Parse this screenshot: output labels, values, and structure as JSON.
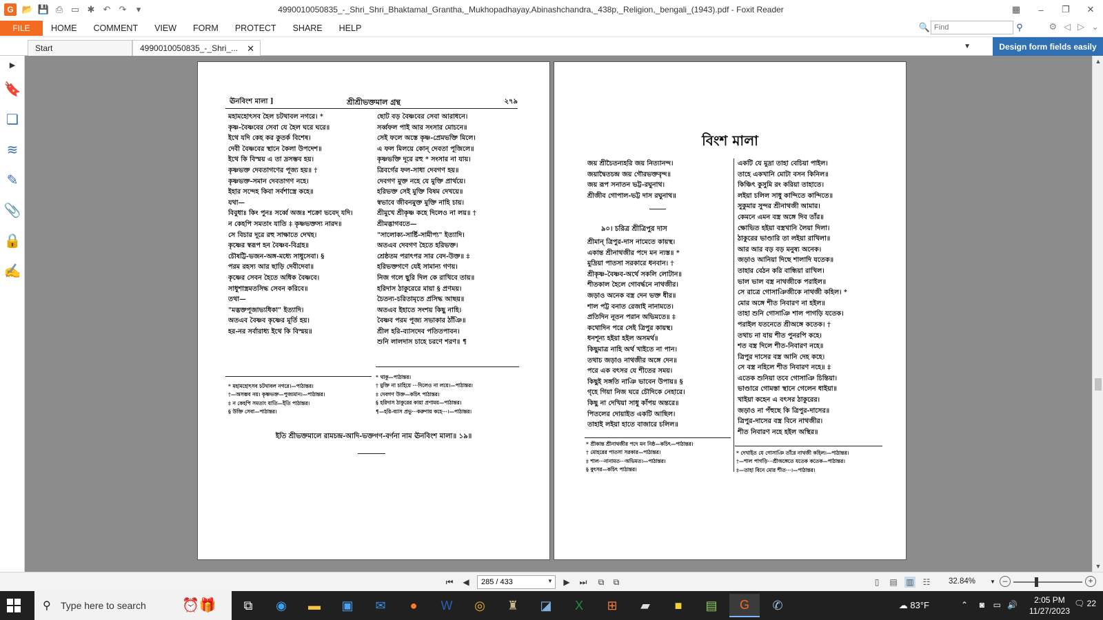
{
  "window": {
    "title": "4990010050835_-_Shri_Shri_Bhaktamal_Grantha,_Mukhopadhayay,Abinashchandra,_438p,_Religion,_bengali_(1943).pdf - Foxit Reader",
    "app_logo": "G"
  },
  "ribbon": {
    "file": "FILE",
    "menus": [
      "HOME",
      "COMMENT",
      "VIEW",
      "FORM",
      "PROTECT",
      "SHARE",
      "HELP"
    ],
    "find_placeholder": "Find"
  },
  "tabs": {
    "start": "Start",
    "document": "4990010050835_-_Shri_...",
    "promo": "Design form fields easily"
  },
  "left_page": {
    "header_left": "ঊনবিংশ মালা ]",
    "header_center": "শ্রীশ্রীভক্তমাল গ্রন্থ",
    "header_right": "২৭৯",
    "col1": [
      "মহামহোৎসব হৈল চটথাবল নগরে। *",
      "কৃষ্ণ-বৈষ্ণবের সেবা যে হৈল ঘরে ঘরে॥",
      "ইথে যদি কেহ কর কুতর্ক বিশেষ।",
      "দেবী বৈষ্ণবের স্থানে কৈলা উপদেশ॥",
      "ইথে কি বিস্ময় এ তা দ্রসম্ভব হয়।",
      "কৃষ্ণভক্ত দেবতাগণের পূজ্য হয়॥ †",
      "কৃষ্ণভক্ত-সমান দেবতাগণ নহে।",
      "ইহার সন্দেহ কিবা সর্বশাস্ত্রে কহে॥",
      "যথা—",
      "বিবুধাঃ কিং পুনঃ সর্ব্বে অজঃ শক্রো ভবেদ্ যদি।",
      "ন কেহপি সমতাং যাতি ‡ কৃষ্ণভক্তস্য নারদ॥",
      "সে বিচার দূরে রহু সাক্ষাতে দেখহ।",
      "কৃষ্ণের স্বরূপ হন বৈষ্ণব-বিগ্রহ॥",
      "চৌষট্টি-ভজন-অঙ্গ-মধ্যে সাধুসেবা। §",
      "পরম রহস্য আর ছাড়ি দেবীদেবা॥",
      "কৃষ্ণের সেবন হৈতে অধিক বৈষ্ণবে।",
      "সাধুশাস্ত্রমতসিদ্ধ সেবন করিবে॥",
      "তথা—",
      "\"মদ্ভক্তপূজাভ্যধিকা\" ইত্যাদি।",
      "অতএব বৈষ্ণব কৃষ্ণের মূর্তি হয়।",
      "হর-নর সর্বারাধ্য ইথে কি বিস্ময়॥"
    ],
    "col2": [
      "ছোট বড় বৈষ্ণবের সেবা আরাধনে।",
      "সর্ব্বফল পাই আর সংসার মোচনে॥",
      "সেই ফলে অস্তে কৃষ্ণ-প্রেমভক্তি মিলে।",
      "এ ফল মিলয়ে কোন্ দেবতা পূজিলে॥",
      "কৃষ্ণভক্তি দূরে রহু * সংসার না যায়।",
      "ত্রিবর্গের ফল-সাধা দেবগণ হয়॥",
      "দেবগণ মুক্ত নহে যে মুক্তি প্রার্থয়ে।",
      "হরিভক্ত সেই মুক্তি বিষম দেখয়ে॥",
      "স্বভাবে জীবনমুক্ত মুক্তি নাহি চায়।",
      "শ্রীমুখে শ্রীকৃষ্ণ কহে দিলেও না লয়॥ †",
      "শ্রীমদ্ভাগবতে—",
      "\"সালোক্য-সার্ষ্টি-সামীপ্য\" ইত্যাদি।",
      "অতএব দেবগণ হৈতে হরিভক্ত।",
      "শ্রেষ্ঠতম পরাৎপর সার বেদ-উক্ত॥ ‡",
      "হরিভক্তগণে যেই সামান্য গণয়।",
      "নিজ গলে ছুরি দিল কে রাখিবে তায়॥",
      "হরিদাস ঠাকুরেরে মায়া § প্রণময়।",
      "চৈতন্য-চরিতামৃতে প্রসিদ্ধ আছয়॥",
      "অতএব ইহাতে সংশয় কিছু নাহি।",
      "বৈষ্ণব পরম পূজ্য সভাকার ঠাঁঞি॥",
      "শ্রীল হরি-ব্যাসদেব পতিতপাবন।",
      "শুনি লালদাস চাহে চরণে শরণ॥ ¶"
    ],
    "fn1": [
      "* মহামহোৎসব চটথাবল নগরে।—পাঠান্তর।",
      "†—অসম্ভব নয়। কৃষ্ণভক্ত—পুজ্যমান।—পাঠান্তর।",
      "‡ ন কেহপি সমতাং যাতি—ইতি পাঠান্তর।",
      "§ উক্তি সেবা—পাঠান্তর।"
    ],
    "fn2": [
      "* থাকু—পাঠান্তর।",
      "† মুক্তি না চাহিয়ে ···দিলেও না লয়ে।—পাঠান্তর।",
      "‡ দেবগণ উক্ত—কচিৎ পাঠান্তর।",
      "§ হরিদাস ঠাকুরের কায়া প্রণাময়—পাঠান্তর।",
      "¶—হরি-ব্যাস প্রভু···করুণায় কহে···।—পাঠান্তর।"
    ],
    "colophon": "ইতি শ্রীভক্তমালে রামচন্দ্র-আদি-ভক্তগণ-বর্ণনা নাম ঊনবিংশ মালা॥ ১৯॥"
  },
  "right_page": {
    "chapter_title": "বিংশ মালা",
    "col1_intro": [
      "জয় শ্রীচৈতন্যহরি জয় নিত্যানন্দ।",
      "জয়াদ্বৈতচন্দ্র জয় গৌরভক্তবৃন্দ॥",
      "জয় রূপ সনাতন ভট্ট-রঘুনাথ।",
      "শ্রীজীব গোপাল-ভট্ট দাস রঘুনাথ॥"
    ],
    "section_title": "৯০। চরিত্র শ্রীত্রিপুর দাস",
    "col1_body": [
      "শ্রীমান্ ত্রিপুর-দাস নামেতে কায়স্থ।",
      "একান্ত শ্রীনাথজীর পদে মন ন্যস্ত॥ *",
      "মুদ্রিয়া পাতসা সরকারে ধনবান। †",
      "শ্রীকৃষ্ণ-বৈষ্ণব-অর্থে সকলি লোটান॥",
      "শীতকাল হৈলে গোবর্দ্ধনে নাথজীর।",
      "জড়াও অনেক বস্ত্র দেন ভক্ত ধীর॥",
      "শাল পট্ট বনাত রেজাই নানামতে।",
      "প্রতিদিন নূতন পরান অভিমতে॥ ‡",
      "কথোদিন পরে সেই ত্রিপুর কায়স্থ।",
      "ধনশূন্য হইয়া হইল অসমর্থ॥",
      "কিছুমাত্র নাহি অর্থ খাইতে না পান।",
      "তথাচ জড়াও নাথজীর অঙ্গে দেন॥",
      "পরে এক বৎসর যে শীতের সময়।",
      "কিছুই সঙ্গতি নাঞি ভাবেন উপায়॥ §",
      "গৃহে গিয়া নিজ ঘরে চৌদিকে নেহারে।",
      "কিছু না দেখিয়া সাধু কাঁপয় অন্তরে॥",
      "পিতলের দোয়াইত একটি আছিল।",
      "তাহাই লইয়া হাতে বাজারে চলিল॥"
    ],
    "col2": [
      "একটি যে মুদ্রা তাহা বেচিয়া পাইল।",
      "তাহে একখানি মোটা বসন কিনিল॥",
      "কিঞ্চিৎ কুসুমি রং করিয়া তাহাতে।",
      "লইয়া চলিল সাধু কান্দিতে কান্দিতে॥",
      "সুকুমার সুন্দর শ্রীনাথজী আমার।",
      "কেমনে এমন বস্ত্র অঙ্গে দিব তাঁর॥",
      "ক্ষোভিত হইয়া বস্ত্রখানি লৈয়া দিলা।",
      "ঠাকুরের ভাণ্ডারি তা লইয়া রাখিলা॥",
      "আর আর বড় বড় মনুষ্য অনেক।",
      "জড়াও আনিয়া দিছে শালাদি যতেক॥",
      "তাহার বেঠন করি বান্ধিয়া রাখিল।",
      "ভাল ভাল বস্ত্র নাথজীকে পরাইল॥",
      "সে রাত্রে গোসাঞিজীকে নাথজী কহিল। *",
      "মোর অঙ্গে শীত নিবারণ না হইল॥",
      "তাহা শুনি গোসাঞি শাল পাগড়ি যতেক।",
      "পরাইল যতনেতে শ্রীঅঙ্গে কতেক। †",
      "তথাচ না যায় শীত পুনরপি কহে।",
      "শত বস্ত্র দিলে শীত-নিবারণ নহে॥",
      "ত্রিপুর দাসের বস্ত্র আনি দেহ কহে।",
      "সে বস্ত্র নহিলে শীত নিবারণ নহে॥ ‡",
      "এতেক শুনিয়া তবে গোসাঞি চিন্তিয়া।",
      "ভাণ্ডারে গোমস্তা স্থানে গেলেন ধাইয়া॥",
      "খাইয়া কহেন এ বৎসর ঠাকুরের।",
      "জড়াও না পঁহুছে কি ত্রিপুর-দাসের॥",
      "ত্রিপুর-দাসের বস্ত্র বিনে নাথজীর।",
      "শীত নিবারণ নহে হইল অস্থির॥"
    ],
    "fn1": [
      "* শ্রীকান্ত শ্রীনাথজীর পদে মন নিষ্ঠ—কচিৎ—পাঠান্তর।",
      "† মোহরের পাতসা সরকার—পাঠান্তর।",
      "‡ শাল···নানামত···অভিমত।—পাঠান্তর।",
      "§ বুৎসর—কচিৎ পাঠান্তর।"
    ],
    "fn2": [
      "* দেখাইত যে গোসাঞি তাঁরে নাথজী কহিল।—পাঠান্তর।",
      "†—শাল পাগড়ি···শ্রীঅঙ্গেতে যতেক কতেক—পাঠান্তর।",
      "‡—তাহা বিনে মোর শীত···।—পাঠান্তর।"
    ]
  },
  "statusbar": {
    "page_value": "285 / 433",
    "zoom": "32.84%",
    "zoom_fraction": 0.33
  },
  "taskbar": {
    "search_placeholder": "Type here to search",
    "weather": "83°F",
    "time": "2:05 PM",
    "date": "11/27/2023",
    "notifications": "22"
  },
  "colors": {
    "accent": "#f26b21",
    "promo": "#2f6fb3",
    "doc_background": "#8c8c8c",
    "taskbar": "#202020"
  },
  "icons": {
    "left_panel": [
      "bookmark-icon",
      "pages-icon",
      "layers-icon",
      "comments-icon",
      "attachment-icon",
      "security-icon",
      "signature-icon"
    ],
    "taskbar": [
      "task-view-icon",
      "edge-icon",
      "file-explorer-icon",
      "store-icon",
      "mail-icon",
      "firefox-icon",
      "word-icon",
      "chrome-icon",
      "app-icon",
      "app-icon",
      "excel-icon",
      "app-icon",
      "app-icon",
      "sticky-notes-icon",
      "app-icon",
      "foxit-icon",
      "app-icon"
    ]
  }
}
